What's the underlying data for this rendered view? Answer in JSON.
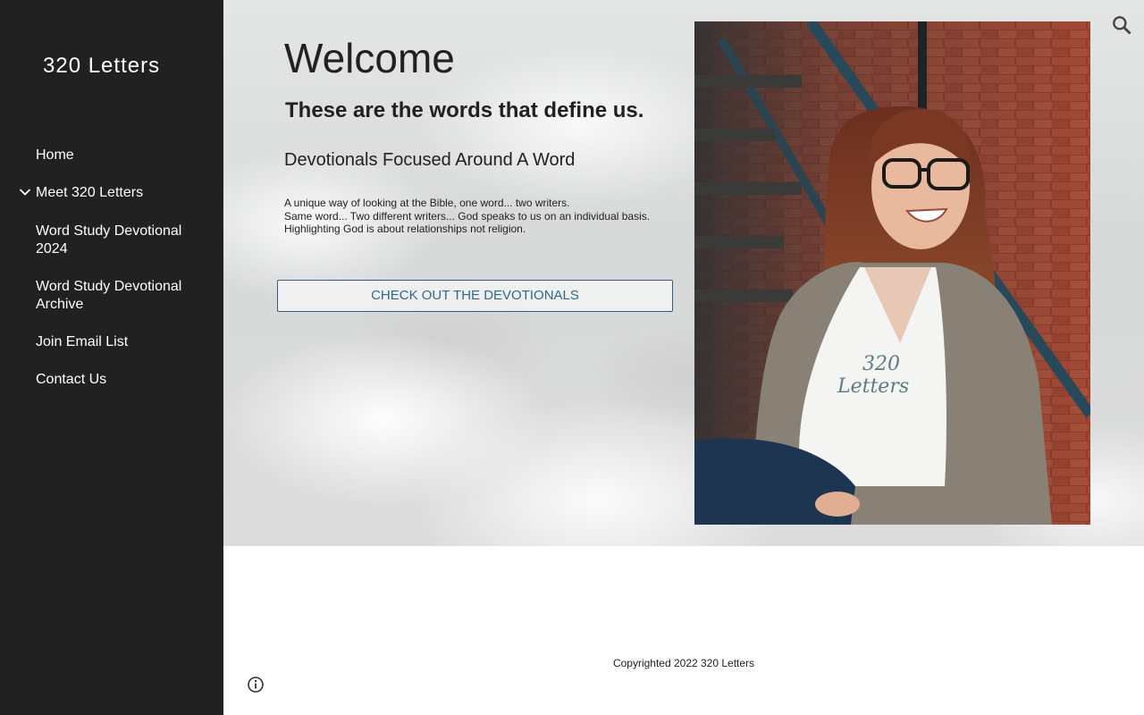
{
  "site": {
    "title": "320 Letters"
  },
  "nav": {
    "items": [
      {
        "label": "Home",
        "expandable": false
      },
      {
        "label": "Meet 320 Letters",
        "expandable": true
      },
      {
        "label": "Word Study Devotional 2024",
        "expandable": false
      },
      {
        "label": "Word Study Devotional Archive",
        "expandable": false
      },
      {
        "label": "Join Email List",
        "expandable": false
      },
      {
        "label": "Contact Us",
        "expandable": false
      }
    ]
  },
  "hero": {
    "heading": "Welcome",
    "subheading": "These are the words that define us.",
    "tagline": "Devotionals Focused Around A Word",
    "blurb": "A unique way of  looking at the Bible, one word... two writers.\nSame word... Two different writers... God speaks to us on an individual basis.\nHighlighting God is about relationships not religion.",
    "cta_label": "CHECK OUT THE DEVOTIONALS",
    "shirt_text": "320 Letters"
  },
  "footer": {
    "copyright": "Copyrighted 2022  320 Letters"
  },
  "icons": {
    "search": "search-icon",
    "info": "info-icon",
    "expand": "chevron-down-icon"
  },
  "colors": {
    "sidebar_bg": "#212121",
    "cta_text": "#2f6a8c",
    "cta_border": "#3a5a78"
  }
}
